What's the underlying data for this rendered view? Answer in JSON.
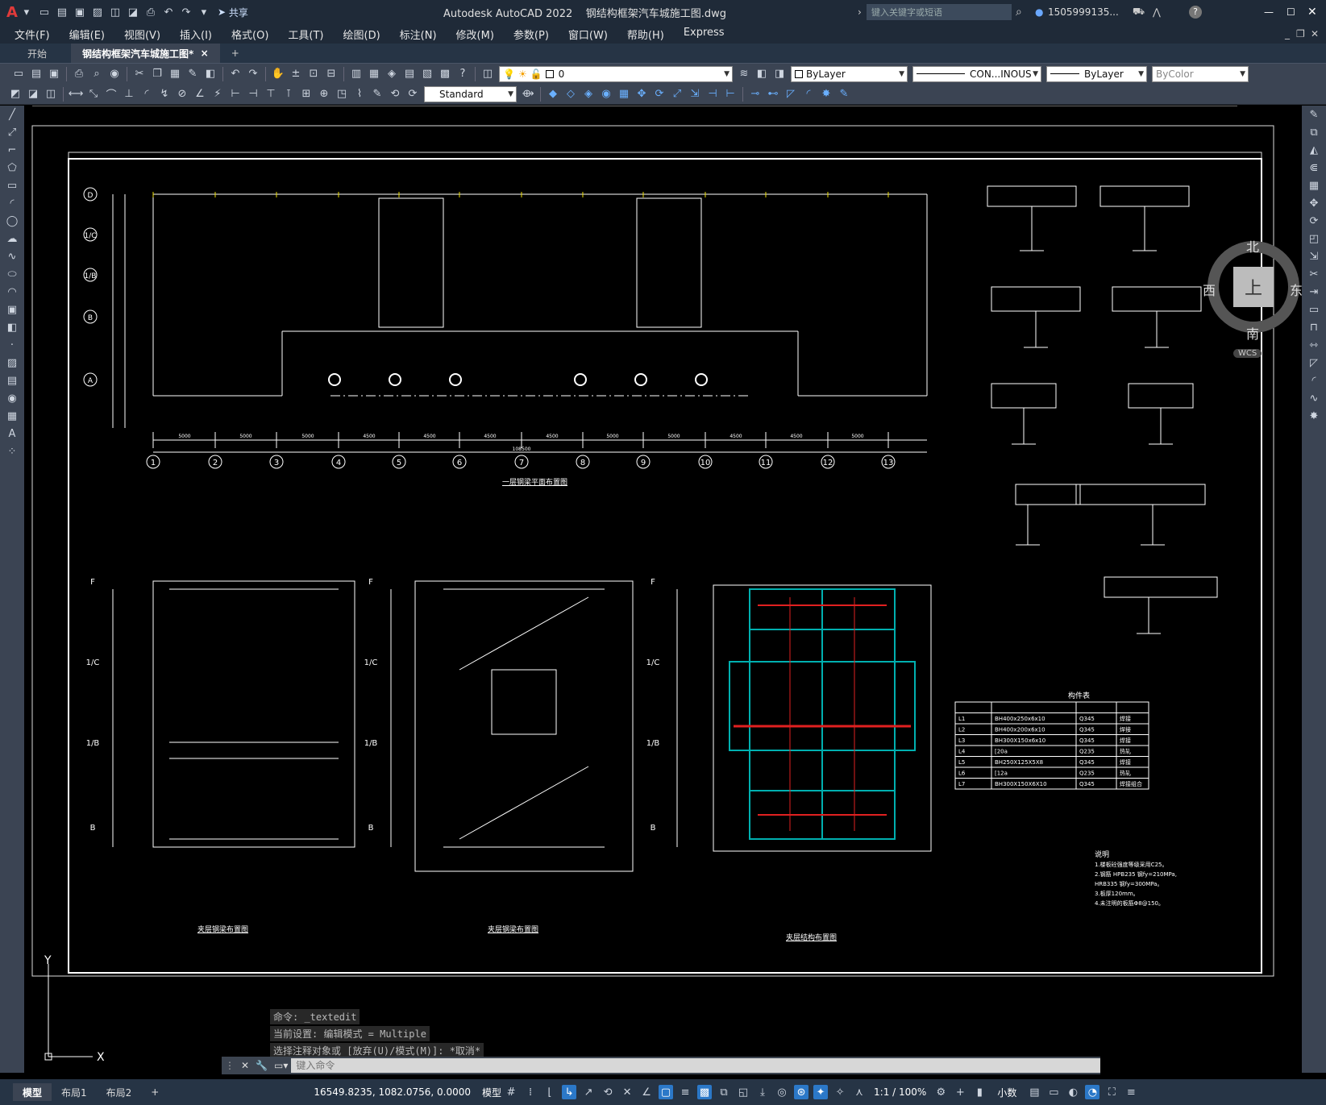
{
  "app": {
    "title": "Autodesk AutoCAD 2022",
    "filename": "钢结构框架汽车城施工图.dwg",
    "share_label": "共享",
    "search_placeholder": "键入关键字或短语",
    "user": "1505999135...",
    "logo": "A"
  },
  "menu": [
    "文件(F)",
    "编辑(E)",
    "视图(V)",
    "插入(I)",
    "格式(O)",
    "工具(T)",
    "绘图(D)",
    "标注(N)",
    "修改(M)",
    "参数(P)",
    "窗口(W)",
    "帮助(H)",
    "Express"
  ],
  "tabs": {
    "start": "开始",
    "drawing": "钢结构框架汽车城施工图*",
    "close": "×",
    "add": "+"
  },
  "toolbar1": {
    "layer": "0",
    "color": "ByLayer",
    "linetype": "CON...INOUS",
    "lineweight": "ByLayer",
    "plotstyle": "ByColor"
  },
  "toolbar2": {
    "textstyle": "Standard"
  },
  "viewcube": {
    "north": "北",
    "south": "南",
    "east": "东",
    "west": "西",
    "top": "上",
    "wcs": "WCS"
  },
  "command": {
    "history": [
      "命令: _textedit",
      "当前设置: 编辑模式 = Multiple",
      "选择注释对象或 [放弃(U)/模式(M)]: *取消*"
    ],
    "placeholder": "键入命令"
  },
  "status": {
    "tabs": [
      "模型",
      "布局1",
      "布局2"
    ],
    "add": "+",
    "coords": "16549.8235, 1082.0756, 0.0000",
    "model": "模型",
    "scale": "1:1 / 100%",
    "units": "小数"
  },
  "drawing": {
    "plan_title": "一层钢梁平面布置图",
    "sub1_title": "夹层钢梁布置图",
    "sub2_title": "夹层钢梁布置图",
    "sub3_title": "夹层结构布置图",
    "table_title": "构件表",
    "notes_title": "说明",
    "grid_cols": [
      "1",
      "2",
      "3",
      "4",
      "5",
      "6",
      "7",
      "8",
      "9",
      "10",
      "11",
      "12",
      "13"
    ],
    "grid_rows": [
      "D",
      "1/C",
      "1/B",
      "B",
      "A"
    ],
    "sub_rows": [
      "F",
      "1/C",
      "1/B",
      "B"
    ],
    "dims": [
      "5000",
      "5000",
      "5000",
      "4500",
      "4500",
      "4500",
      "4500",
      "5000",
      "5000",
      "4500",
      "4500",
      "5000",
      "5000"
    ],
    "total_dim": "108500",
    "members": [
      [
        "L1",
        "BH400x250x6x10",
        "Q345",
        "焊接"
      ],
      [
        "L2",
        "BH400x200x6x10",
        "Q345",
        "焊接"
      ],
      [
        "L3",
        "BH300X150x6x10",
        "Q345",
        "焊接"
      ],
      [
        "L4",
        "[20a",
        "Q235",
        "热轧"
      ],
      [
        "L5",
        "BH250X125X5X8",
        "Q345",
        "焊接"
      ],
      [
        "L6",
        "[12a",
        "Q235",
        "热轧"
      ],
      [
        "L7",
        "BH300X150X6X10",
        "Q345",
        "焊接组合"
      ]
    ],
    "notes": [
      "1.楼板砼强度等级采用C25。",
      "2.钢筋 HPB235 钢fy=210MPa,",
      "  HRB335 钢fy=300MPa。",
      "3.板厚120mm。",
      "4.未注明的板筋Φ8@150。"
    ]
  }
}
